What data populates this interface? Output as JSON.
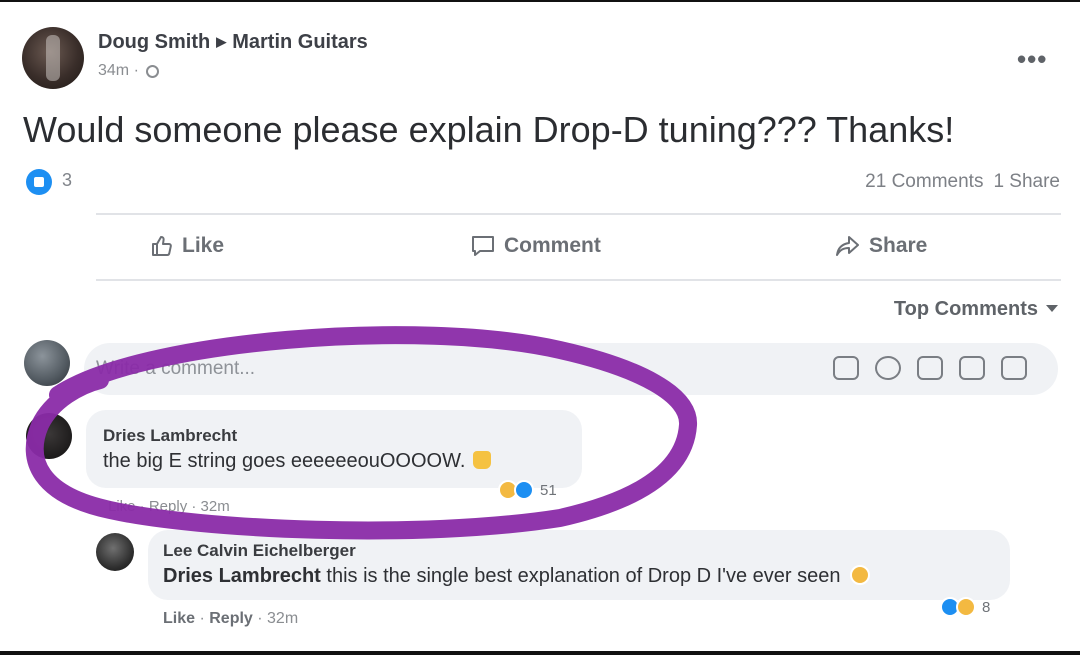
{
  "post": {
    "author": "Doug Smith",
    "target_page": "Martin Guitars",
    "time": "34m",
    "visibility_icon": "globe-icon",
    "more_icon": "•••",
    "text": "Would someone please explain Drop-D tuning??? Thanks!",
    "reaction_count": "3",
    "comments_count": "21 Comments",
    "shares_count": "1 Share"
  },
  "actions": {
    "like": "Like",
    "comment": "Comment",
    "share": "Share"
  },
  "sort": {
    "label": "Top Comments"
  },
  "composer": {
    "placeholder": "Write a comment..."
  },
  "comments": [
    {
      "author": "Dries Lambrecht",
      "text": "the big E string goes eeeeeeouOOOOW.",
      "reaction_count": "51",
      "meta": "Like · Reply · 32m"
    },
    {
      "author": "Lee Calvin Eichelberger",
      "mention": "Dries Lambrecht",
      "text": "this is the single best explanation of Drop D I've ever seen",
      "reaction_count": "8",
      "like_label": "Like",
      "reply_label": "Reply",
      "time": "32m"
    }
  ],
  "colors": {
    "accent_blue": "#1d8ff2",
    "annotation_purple": "#8a2ba8",
    "bubble_bg": "#f0f2f5"
  }
}
